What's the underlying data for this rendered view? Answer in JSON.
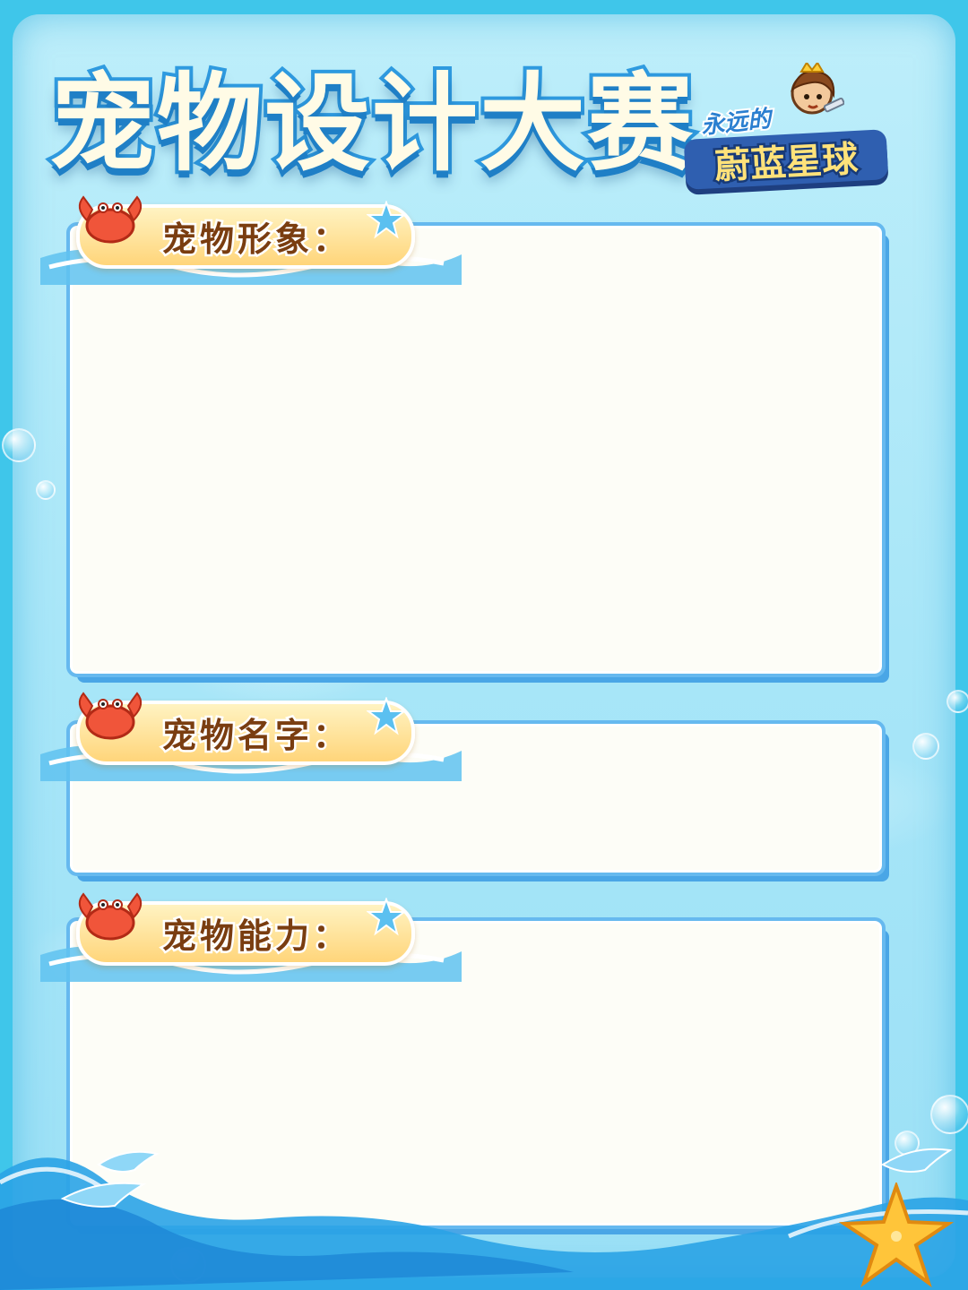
{
  "title": "宠物设计大赛",
  "logo": {
    "subtitle": "永远的",
    "name": "蔚蓝星球"
  },
  "sections": [
    {
      "label": "宠物形象：",
      "content": ""
    },
    {
      "label": "宠物名字：",
      "content": ""
    },
    {
      "label": "宠物能力：",
      "content": ""
    }
  ],
  "colors": {
    "background": "#3fc6ea",
    "panel": "#fdfdf7",
    "panel_border": "#66b9ef",
    "title_fill": "#fffbe6",
    "title_stroke": "#2f9be0",
    "label_text": "#7a3d10",
    "label_pill": "#ffd57a"
  },
  "icons": [
    "crab-icon",
    "starfish-icon",
    "bubble-icon",
    "dolphin-icon",
    "character-mascot-icon"
  ]
}
